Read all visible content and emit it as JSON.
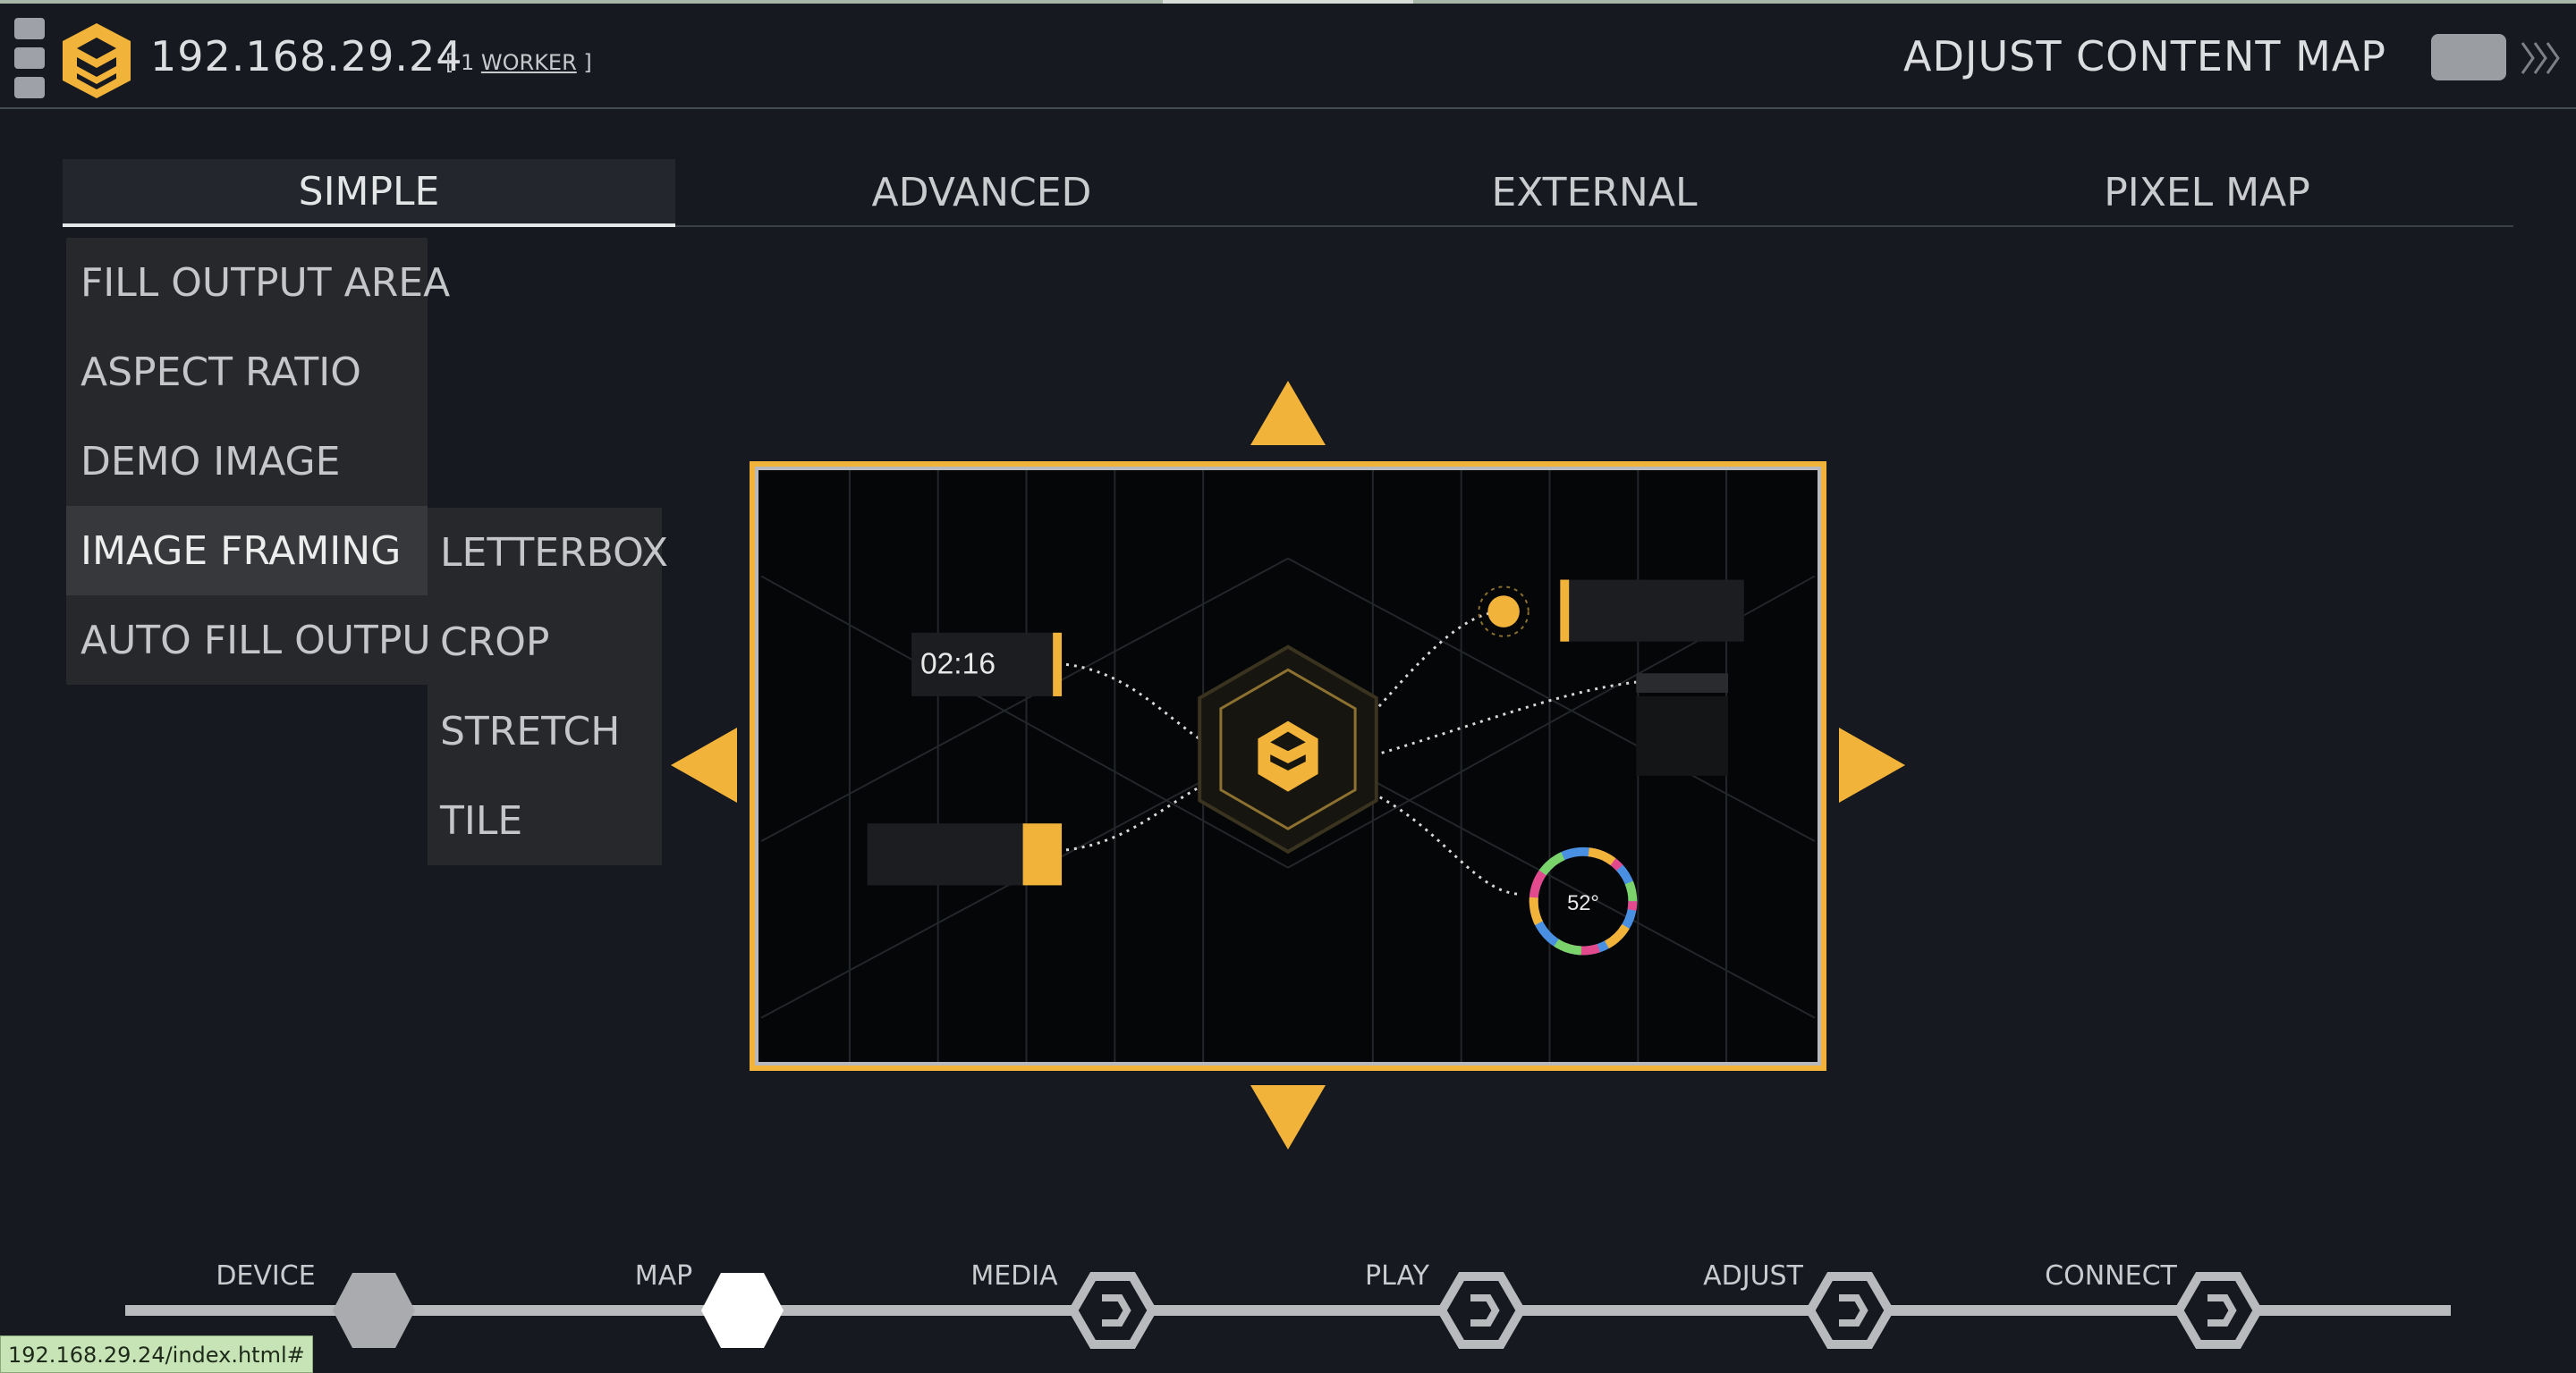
{
  "header": {
    "device_ip": "192.168.29.24",
    "worker_prefix": "[ 1 ",
    "worker_link": "WORKER",
    "worker_suffix": " ]",
    "page_title": "ADJUST CONTENT MAP"
  },
  "tabs": [
    {
      "label": "SIMPLE",
      "active": true
    },
    {
      "label": "ADVANCED"
    },
    {
      "label": "EXTERNAL"
    },
    {
      "label": "PIXEL MAP"
    }
  ],
  "options": [
    {
      "label": "FILL OUTPUT AREA"
    },
    {
      "label": "ASPECT RATIO"
    },
    {
      "label": "DEMO IMAGE"
    },
    {
      "label": "IMAGE FRAMING",
      "active": true
    },
    {
      "label": "AUTO FILL OUTPUT"
    }
  ],
  "framing_options": [
    {
      "label": "LETTERBOX"
    },
    {
      "label": "CROP"
    },
    {
      "label": "STRETCH"
    },
    {
      "label": "TILE"
    }
  ],
  "preview": {
    "clock_text": "02:16",
    "gauge_text": "52°"
  },
  "stepper": {
    "steps": [
      {
        "label": "DEVICE",
        "state": "done"
      },
      {
        "label": "MAP",
        "state": "current"
      },
      {
        "label": "MEDIA",
        "state": "pending"
      },
      {
        "label": "PLAY",
        "state": "pending"
      },
      {
        "label": "ADJUST",
        "state": "pending"
      },
      {
        "label": "CONNECT",
        "state": "pending"
      }
    ]
  },
  "status_url": "192.168.29.24/index.html#",
  "colors": {
    "background": "#16191f",
    "accent": "#f2b33a",
    "panel": "#26282b",
    "step_done": "#a9abae",
    "step_current": "#ffffff"
  },
  "icons": {
    "menu": "menu-icon",
    "logo": "hexagon-logo-icon",
    "more": "chevron-right-icon"
  }
}
